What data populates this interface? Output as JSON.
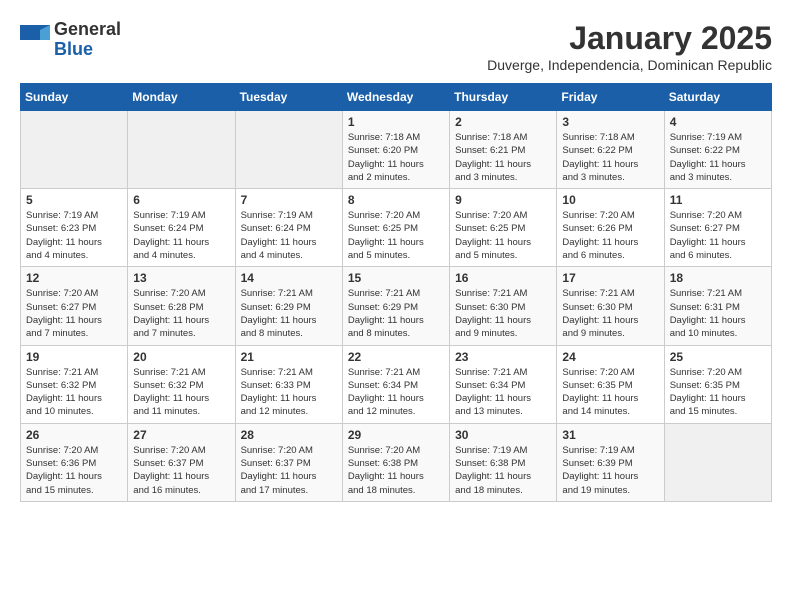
{
  "logo": {
    "general": "General",
    "blue": "Blue"
  },
  "title": "January 2025",
  "subtitle": "Duverge, Independencia, Dominican Republic",
  "weekdays": [
    "Sunday",
    "Monday",
    "Tuesday",
    "Wednesday",
    "Thursday",
    "Friday",
    "Saturday"
  ],
  "weeks": [
    [
      {
        "day": "",
        "info": ""
      },
      {
        "day": "",
        "info": ""
      },
      {
        "day": "",
        "info": ""
      },
      {
        "day": "1",
        "info": "Sunrise: 7:18 AM\nSunset: 6:20 PM\nDaylight: 11 hours\nand 2 minutes."
      },
      {
        "day": "2",
        "info": "Sunrise: 7:18 AM\nSunset: 6:21 PM\nDaylight: 11 hours\nand 3 minutes."
      },
      {
        "day": "3",
        "info": "Sunrise: 7:18 AM\nSunset: 6:22 PM\nDaylight: 11 hours\nand 3 minutes."
      },
      {
        "day": "4",
        "info": "Sunrise: 7:19 AM\nSunset: 6:22 PM\nDaylight: 11 hours\nand 3 minutes."
      }
    ],
    [
      {
        "day": "5",
        "info": "Sunrise: 7:19 AM\nSunset: 6:23 PM\nDaylight: 11 hours\nand 4 minutes."
      },
      {
        "day": "6",
        "info": "Sunrise: 7:19 AM\nSunset: 6:24 PM\nDaylight: 11 hours\nand 4 minutes."
      },
      {
        "day": "7",
        "info": "Sunrise: 7:19 AM\nSunset: 6:24 PM\nDaylight: 11 hours\nand 4 minutes."
      },
      {
        "day": "8",
        "info": "Sunrise: 7:20 AM\nSunset: 6:25 PM\nDaylight: 11 hours\nand 5 minutes."
      },
      {
        "day": "9",
        "info": "Sunrise: 7:20 AM\nSunset: 6:25 PM\nDaylight: 11 hours\nand 5 minutes."
      },
      {
        "day": "10",
        "info": "Sunrise: 7:20 AM\nSunset: 6:26 PM\nDaylight: 11 hours\nand 6 minutes."
      },
      {
        "day": "11",
        "info": "Sunrise: 7:20 AM\nSunset: 6:27 PM\nDaylight: 11 hours\nand 6 minutes."
      }
    ],
    [
      {
        "day": "12",
        "info": "Sunrise: 7:20 AM\nSunset: 6:27 PM\nDaylight: 11 hours\nand 7 minutes."
      },
      {
        "day": "13",
        "info": "Sunrise: 7:20 AM\nSunset: 6:28 PM\nDaylight: 11 hours\nand 7 minutes."
      },
      {
        "day": "14",
        "info": "Sunrise: 7:21 AM\nSunset: 6:29 PM\nDaylight: 11 hours\nand 8 minutes."
      },
      {
        "day": "15",
        "info": "Sunrise: 7:21 AM\nSunset: 6:29 PM\nDaylight: 11 hours\nand 8 minutes."
      },
      {
        "day": "16",
        "info": "Sunrise: 7:21 AM\nSunset: 6:30 PM\nDaylight: 11 hours\nand 9 minutes."
      },
      {
        "day": "17",
        "info": "Sunrise: 7:21 AM\nSunset: 6:30 PM\nDaylight: 11 hours\nand 9 minutes."
      },
      {
        "day": "18",
        "info": "Sunrise: 7:21 AM\nSunset: 6:31 PM\nDaylight: 11 hours\nand 10 minutes."
      }
    ],
    [
      {
        "day": "19",
        "info": "Sunrise: 7:21 AM\nSunset: 6:32 PM\nDaylight: 11 hours\nand 10 minutes."
      },
      {
        "day": "20",
        "info": "Sunrise: 7:21 AM\nSunset: 6:32 PM\nDaylight: 11 hours\nand 11 minutes."
      },
      {
        "day": "21",
        "info": "Sunrise: 7:21 AM\nSunset: 6:33 PM\nDaylight: 11 hours\nand 12 minutes."
      },
      {
        "day": "22",
        "info": "Sunrise: 7:21 AM\nSunset: 6:34 PM\nDaylight: 11 hours\nand 12 minutes."
      },
      {
        "day": "23",
        "info": "Sunrise: 7:21 AM\nSunset: 6:34 PM\nDaylight: 11 hours\nand 13 minutes."
      },
      {
        "day": "24",
        "info": "Sunrise: 7:20 AM\nSunset: 6:35 PM\nDaylight: 11 hours\nand 14 minutes."
      },
      {
        "day": "25",
        "info": "Sunrise: 7:20 AM\nSunset: 6:35 PM\nDaylight: 11 hours\nand 15 minutes."
      }
    ],
    [
      {
        "day": "26",
        "info": "Sunrise: 7:20 AM\nSunset: 6:36 PM\nDaylight: 11 hours\nand 15 minutes."
      },
      {
        "day": "27",
        "info": "Sunrise: 7:20 AM\nSunset: 6:37 PM\nDaylight: 11 hours\nand 16 minutes."
      },
      {
        "day": "28",
        "info": "Sunrise: 7:20 AM\nSunset: 6:37 PM\nDaylight: 11 hours\nand 17 minutes."
      },
      {
        "day": "29",
        "info": "Sunrise: 7:20 AM\nSunset: 6:38 PM\nDaylight: 11 hours\nand 18 minutes."
      },
      {
        "day": "30",
        "info": "Sunrise: 7:19 AM\nSunset: 6:38 PM\nDaylight: 11 hours\nand 18 minutes."
      },
      {
        "day": "31",
        "info": "Sunrise: 7:19 AM\nSunset: 6:39 PM\nDaylight: 11 hours\nand 19 minutes."
      },
      {
        "day": "",
        "info": ""
      }
    ]
  ]
}
